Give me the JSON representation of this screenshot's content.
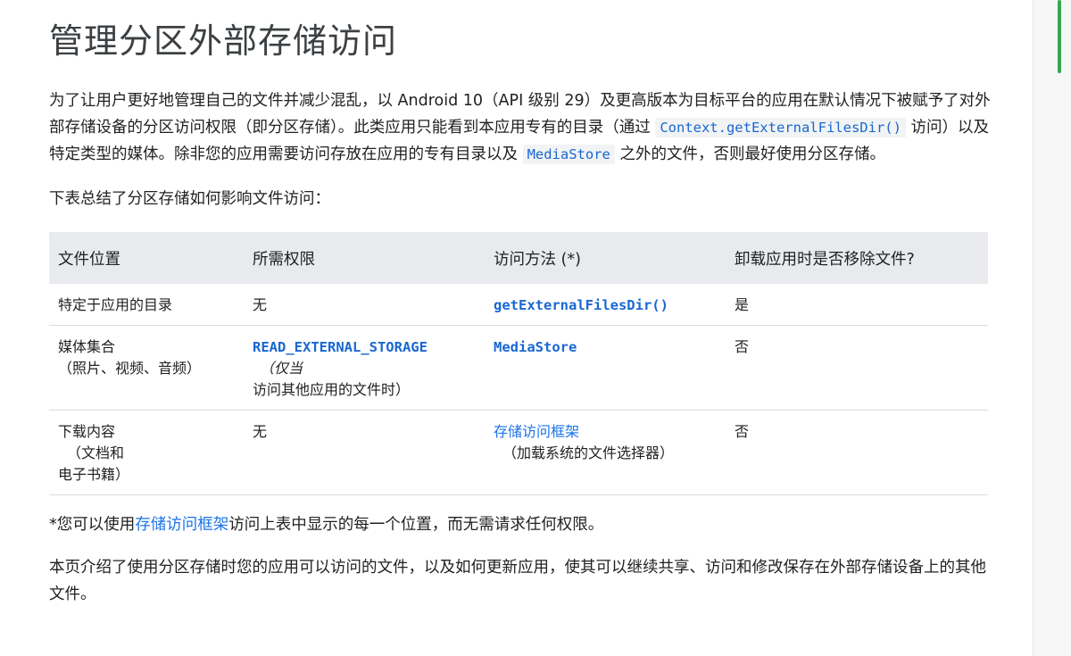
{
  "page": {
    "title": "管理分区外部存储访问",
    "intro": {
      "part1": "为了让用户更好地管理自己的文件并减少混乱，以 Android 10（API 级别 29）及更高版本为目标平台的应用在默认情况下被赋予了对外部存储设备的分区访问权限（即分区存储）。此类应用只能看到本应用专有的目录（通过 ",
      "code1": "Context.getExternalFilesDir()",
      "part2": " 访问）以及特定类型的媒体。除非您的应用需要访问存放在应用的专有目录以及 ",
      "code2": "MediaStore",
      "part3": " 之外的文件，否则最好使用分区存储。"
    },
    "summary": "下表总结了分区存储如何影响文件访问：",
    "table": {
      "headers": [
        "文件位置",
        "所需权限",
        "访问方法 (*)",
        "卸载应用时是否移除文件?"
      ],
      "rows": [
        {
          "location": "特定于应用的目录",
          "location_sub": "",
          "permission": "无",
          "permission_cond": "",
          "permission_sub": "",
          "method": "getExternalFilesDir()",
          "method_sub": "",
          "removed": "是"
        },
        {
          "location": "媒体集合",
          "location_sub": "（照片、视频、音频）",
          "permission": "READ_EXTERNAL_STORAGE",
          "permission_cond": "（仅当",
          "permission_sub": "访问其他应用的文件时）",
          "method": "MediaStore",
          "method_sub": "",
          "removed": "否"
        },
        {
          "location": "下载内容",
          "location_sub": "（文档和",
          "location_sub2": "电子书籍）",
          "permission": "无",
          "permission_cond": "",
          "permission_sub": "",
          "method": "存储访问框架",
          "method_sub": "（加载系统的文件选择器）",
          "removed": "否"
        }
      ]
    },
    "note": {
      "prefix": "*您可以使用",
      "link": "存储访问框架",
      "suffix": "访问上表中显示的每一个位置，而无需请求任何权限。"
    },
    "ending": "本页介绍了使用分区存储时您的应用可以访问的文件，以及如何更新应用，使其可以继续共享、访问和修改保存在外部存储设备上的其他文件。"
  },
  "colors": {
    "link": "#1a73e8",
    "code_link": "#1967d2",
    "header_bg": "#e8eaed",
    "scroll_accent": "#34a853"
  }
}
